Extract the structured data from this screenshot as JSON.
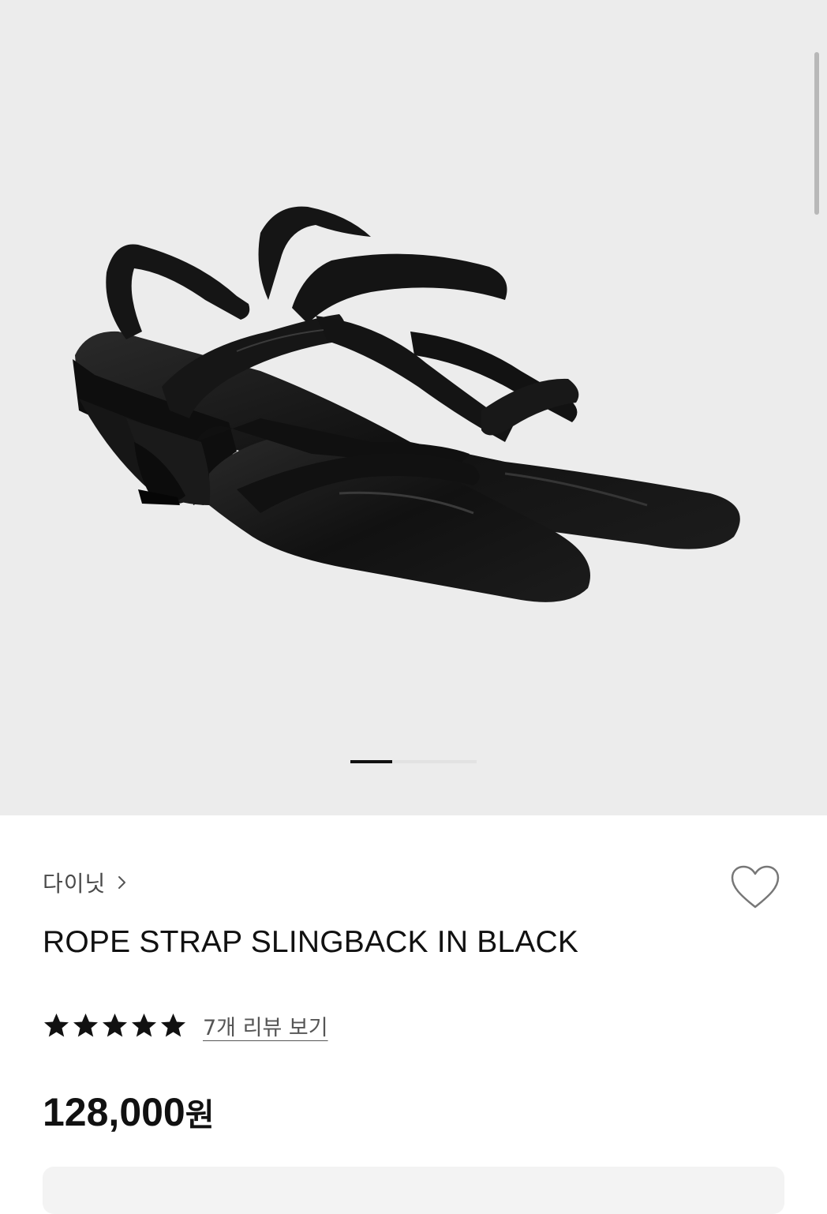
{
  "product": {
    "brand": "다이닛",
    "title": "ROPE STRAP SLINGBACK IN BLACK",
    "rating": 5,
    "rating_max": 5,
    "reviews_label": "7개 리뷰 보기",
    "price": "128,000",
    "currency_unit": "원"
  },
  "gallery": {
    "active_index": 1,
    "background_color": "#ececec",
    "image_alt": "black pointed-toe slingback shoes"
  },
  "icons": {
    "brand_chevron": "chevron-right-icon",
    "wishlist": "heart-outline-icon",
    "star": "star-filled-icon"
  },
  "colors": {
    "text_primary": "#111111",
    "text_secondary": "#4a4a4a",
    "accent": "#111111"
  }
}
